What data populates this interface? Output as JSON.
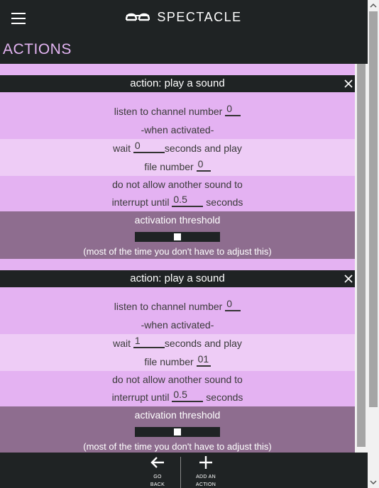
{
  "app": {
    "brand": "SPECTACLE",
    "section_title": "ACTIONS"
  },
  "cards": [
    {
      "header": "action: play a sound",
      "channel_label": "listen to channel number",
      "channel_value": "0",
      "activated_label": "-when activated-",
      "wait_label": "wait",
      "wait_value": "0",
      "seconds_and_play": "seconds and play",
      "file_label": "file number",
      "file_value": "0",
      "interrupt_line1": "do not allow another sound to",
      "interrupt_label": "interrupt until",
      "interrupt_value": "0.5",
      "interrupt_seconds": "seconds",
      "threshold_title": "activation threshold",
      "threshold_level": 0.5,
      "threshold_note": "(most of the time you don't have to adjust this)"
    },
    {
      "header": "action: play a sound",
      "channel_label": "listen to channel number",
      "channel_value": "0",
      "activated_label": "-when activated-",
      "wait_label": "wait",
      "wait_value": "1",
      "seconds_and_play": "seconds and play",
      "file_label": "file number",
      "file_value": "01",
      "interrupt_line1": "do not allow another sound to",
      "interrupt_label": "interrupt until",
      "interrupt_value": "0.5",
      "interrupt_seconds": "seconds",
      "threshold_title": "activation threshold",
      "threshold_level": 0.5,
      "threshold_note": "(most of the time you don't have to adjust this)"
    }
  ],
  "footer": {
    "go_back": [
      "GO",
      "BACK"
    ],
    "add_action": [
      "ADD AN",
      "ACTION"
    ]
  },
  "icons": {
    "menu": "hamburger-icon",
    "logo": "glasses-logo-icon",
    "close": "close-icon",
    "back": "arrow-left-icon",
    "add": "plus-icon"
  },
  "colors": {
    "dark": "#1f2324",
    "accent_text": "#e3b4f2",
    "row_a": "#e4b2f2",
    "row_b": "#eeccf6",
    "threshold_bg": "#8e6d8f"
  }
}
